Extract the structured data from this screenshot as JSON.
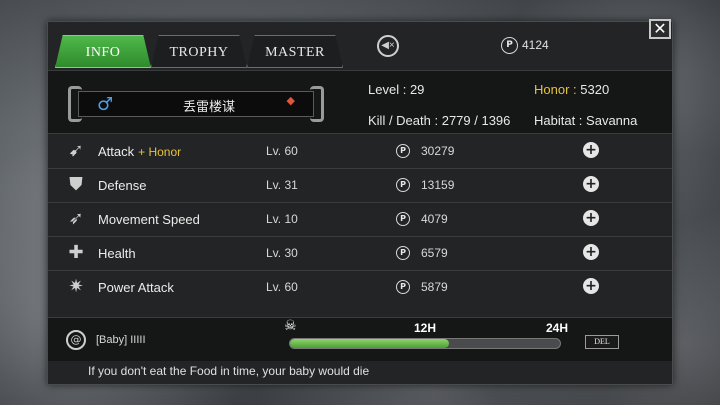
{
  "tabs": [
    {
      "label": "INFO",
      "active": true
    },
    {
      "label": "TROPHY",
      "active": false
    },
    {
      "label": "MASTER",
      "active": false
    }
  ],
  "header": {
    "close_label": "✕",
    "points": "4124",
    "mute_icon": "speaker-mute-icon",
    "coin_symbol": "P"
  },
  "profile": {
    "name": "丢雷楼谋",
    "gender_symbol": "♂",
    "rank_symbol": "◆",
    "level_label": "Level :",
    "level": "29",
    "honor_label": "Honor :",
    "honor": "5320",
    "kd_label": "Kill / Death :",
    "kd": "2779 / 1396",
    "habitat_label": "Habitat :",
    "habitat": "Savanna"
  },
  "stats": [
    {
      "name": "Attack",
      "bonus": "+ Honor",
      "level": "Lv. 60",
      "cost": "30279",
      "icon": "claw-icon",
      "glyph": "➹"
    },
    {
      "name": "Defense",
      "bonus": "",
      "level": "Lv. 31",
      "cost": "13159",
      "icon": "shield-icon",
      "glyph": "⛊"
    },
    {
      "name": "Movement Speed",
      "bonus": "",
      "level": "Lv. 10",
      "cost": "4079",
      "icon": "wing-icon",
      "glyph": "➶"
    },
    {
      "name": "Health",
      "bonus": "",
      "level": "Lv. 30",
      "cost": "6579",
      "icon": "health-cross-icon",
      "glyph": "✚"
    },
    {
      "name": "Power Attack",
      "bonus": "",
      "level": "Lv. 60",
      "cost": "5879",
      "icon": "burst-icon",
      "glyph": "✷"
    }
  ],
  "baby": {
    "label": "[Baby]",
    "bars": "IIIII",
    "tick_12": "12H",
    "tick_24": "24H",
    "food_fraction": 0.59,
    "del_label": "DEL",
    "hint": "If you don't eat the Food in time, your baby would die"
  },
  "colors": {
    "tab_active": "#3fa03a",
    "honor_gold": "#e8c23a",
    "gender_blue": "#4da0e8",
    "food_green": "#6bbd4e"
  }
}
